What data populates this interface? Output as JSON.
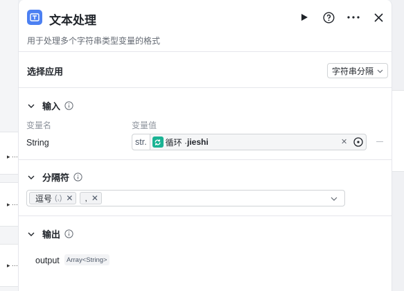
{
  "canvas": {
    "left_cards": [
      {
        "label": "▸ ···"
      },
      {
        "label": "▸ ···"
      },
      {
        "label": "▸ ···"
      }
    ]
  },
  "header": {
    "title": "文本处理",
    "description": "用于处理多个字符串类型变量的格式",
    "icons": [
      "text-tool-icon",
      "play-icon",
      "help-icon",
      "more-icon",
      "close-icon"
    ]
  },
  "select_app": {
    "label": "选择应用",
    "value": "字符串分隔"
  },
  "input_section": {
    "label": "输入",
    "col_name": "变量名",
    "col_value": "变量值",
    "rows": [
      {
        "name": "String",
        "type": "str.",
        "ref_prefix": "循环 · ",
        "ref_name": "jieshi"
      }
    ]
  },
  "separator_section": {
    "label": "分隔符",
    "chips": [
      {
        "label": "逗号",
        "sub": "(,)"
      },
      {
        "label": ",",
        "sub": ""
      }
    ]
  },
  "output_section": {
    "label": "输出",
    "name": "output",
    "type": "Array<String>"
  },
  "colors": {
    "accent": "#4c80f2",
    "loop": "#1ab394"
  }
}
